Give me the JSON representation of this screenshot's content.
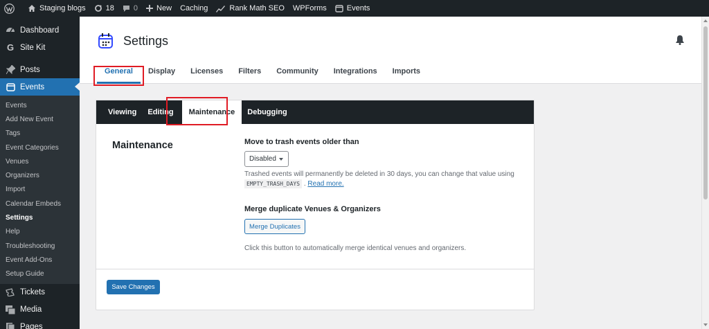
{
  "admin_bar": {
    "site_name": "Staging blogs",
    "updates_count": "18",
    "comments_count": "0",
    "new_label": "New",
    "caching_label": "Caching",
    "rankmath_label": "Rank Math SEO",
    "wpforms_label": "WPForms",
    "events_label": "Events"
  },
  "sidebar": {
    "top": [
      {
        "label": "Dashboard",
        "icon": "dashboard-icon"
      },
      {
        "label": "Site Kit",
        "icon": "google-icon"
      },
      {
        "label": "Posts",
        "icon": "pin-icon"
      },
      {
        "label": "Events",
        "icon": "calendar-icon"
      }
    ],
    "events_submenu": [
      "Events",
      "Add New Event",
      "Tags",
      "Event Categories",
      "Venues",
      "Organizers",
      "Import",
      "Calendar Embeds",
      "Settings",
      "Help",
      "Troubleshooting",
      "Event Add-Ons",
      "Setup Guide"
    ],
    "bottom": [
      {
        "label": "Tickets",
        "icon": "ticket-icon"
      },
      {
        "label": "Media",
        "icon": "media-icon"
      },
      {
        "label": "Pages",
        "icon": "pages-icon"
      }
    ]
  },
  "header": {
    "title": "Settings",
    "tabs": [
      "General",
      "Display",
      "Licenses",
      "Filters",
      "Community",
      "Integrations",
      "Imports"
    ],
    "active_tab": "General"
  },
  "panel": {
    "subtabs": [
      "Viewing",
      "Editing",
      "Maintenance",
      "Debugging"
    ],
    "active_subtab": "Maintenance",
    "section_title": "Maintenance",
    "trash": {
      "label": "Move to trash events older than",
      "selected": "Disabled",
      "desc_line1": "Trashed events will permanently be deleted in 30 days, you can change that value using",
      "code": "EMPTY_TRASH_DAYS",
      "desc_sep": ".",
      "read_more": "Read more."
    },
    "merge": {
      "label": "Merge duplicate Venues & Organizers",
      "button": "Merge Duplicates",
      "desc": "Click this button to automatically merge identical venues and organizers."
    },
    "save_button": "Save Changes"
  },
  "colors": {
    "admin_dark": "#1d2327",
    "accent": "#2271b1",
    "highlight": "#e01b24"
  }
}
